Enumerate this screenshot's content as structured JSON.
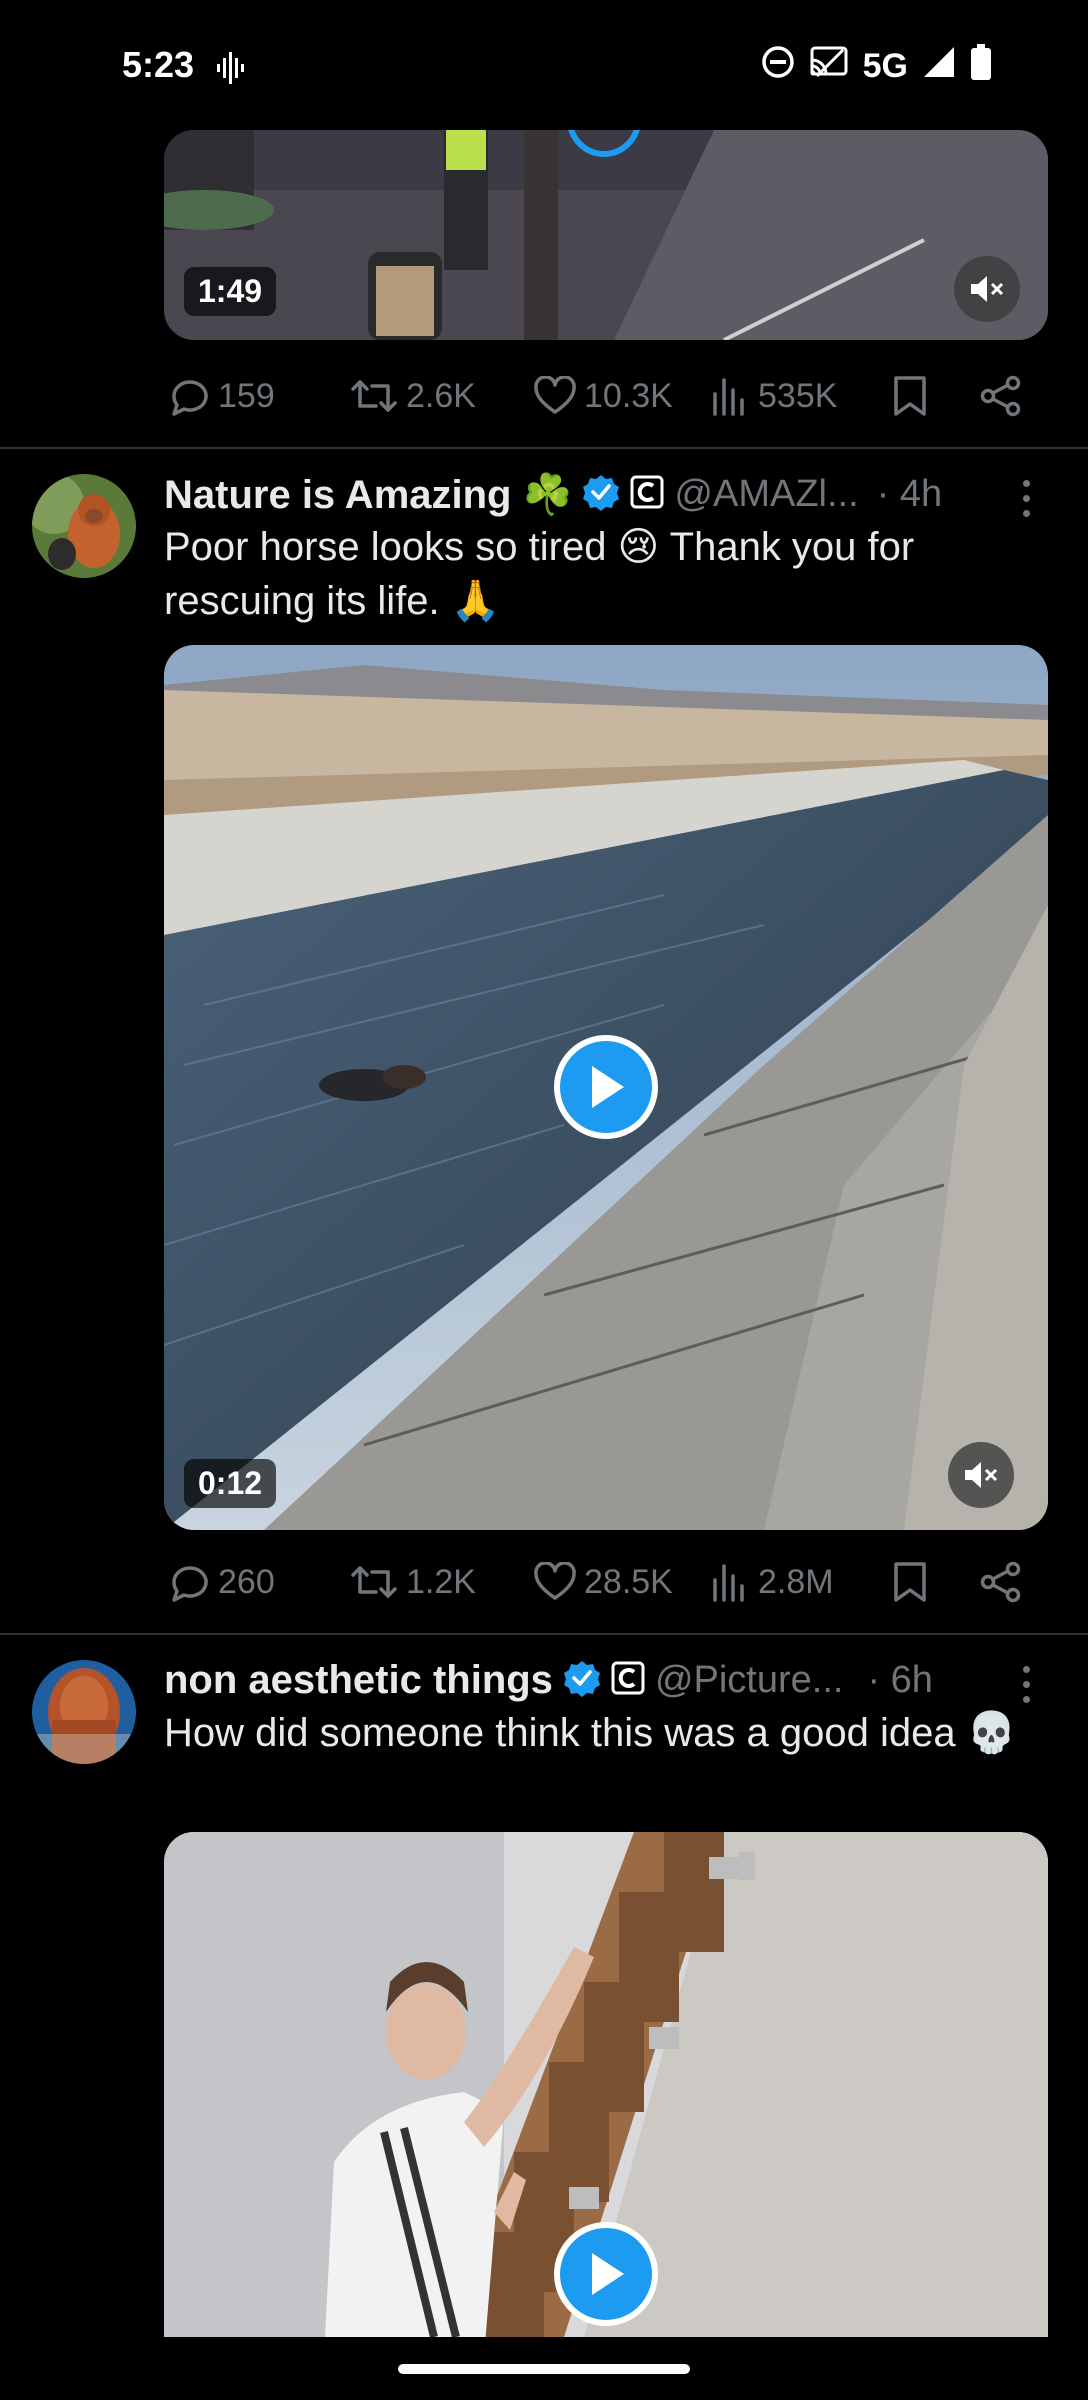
{
  "status_bar": {
    "time": "5:23",
    "network": "5G"
  },
  "tweet_prev": {
    "video_duration": "1:49",
    "stats": {
      "replies": "159",
      "reposts": "2.6K",
      "likes": "10.3K",
      "views": "535K"
    }
  },
  "tweet1": {
    "name": "Nature is Amazing ☘️",
    "handle": "@AMAZl...",
    "time": "· 4h",
    "text": "Poor horse looks so tired 😢 Thank you for rescuing its life. 🙏",
    "video_duration": "0:12",
    "stats": {
      "replies": "260",
      "reposts": "1.2K",
      "likes": "28.5K",
      "views": "2.8M"
    }
  },
  "tweet2": {
    "name": "non aesthetic things",
    "handle": "@Picture...",
    "time": "· 6h",
    "text": "How did someone think this was a good idea 💀"
  },
  "icons": {
    "reply": "reply-icon",
    "repost": "repost-icon",
    "like": "like-icon",
    "views": "views-icon",
    "bookmark": "bookmark-icon",
    "share": "share-icon",
    "verified": "verified-badge-icon",
    "mute": "mute-icon",
    "play": "play-icon"
  },
  "colors": {
    "accent": "#1d9bf0",
    "muted": "#71767b",
    "background": "#000000"
  }
}
